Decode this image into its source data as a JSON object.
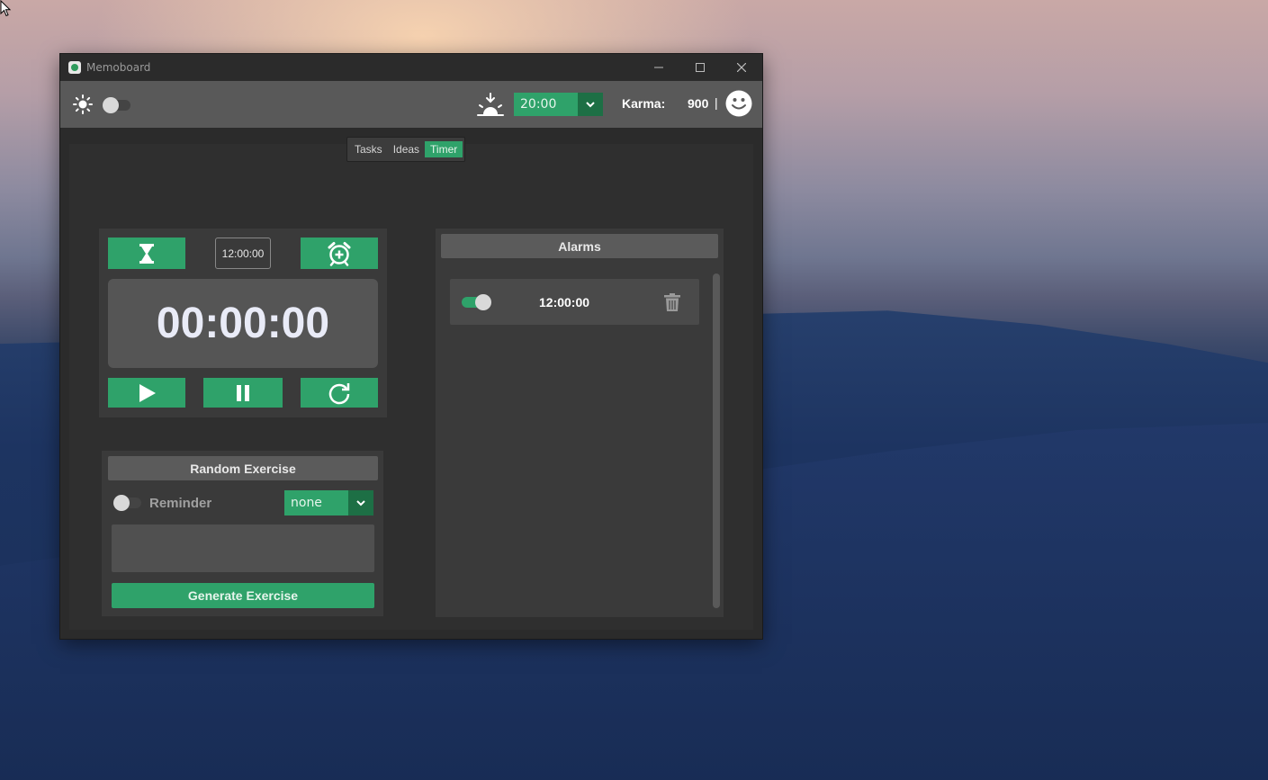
{
  "window": {
    "title": "Memoboard"
  },
  "toolbar": {
    "theme_toggle": "off",
    "time_select": "20:00",
    "karma_label": "Karma:",
    "karma_value": "900",
    "karma_separator": "|"
  },
  "tabs": [
    {
      "label": "Tasks",
      "active": false
    },
    {
      "label": "Ideas",
      "active": false
    },
    {
      "label": "Timer",
      "active": true
    }
  ],
  "timer": {
    "alarm_time_input": "12:00:00",
    "display": "00:00:00"
  },
  "exercise": {
    "title": "Random Exercise",
    "reminder_label": "Reminder",
    "reminder_on": false,
    "interval_select": "none",
    "text": "",
    "generate_label": "Generate Exercise"
  },
  "alarms": {
    "title": "Alarms",
    "items": [
      {
        "time": "12:00:00",
        "enabled": true
      }
    ]
  },
  "colors": {
    "accent": "#2fa26a",
    "accent_dark": "#1d6f45",
    "panel": "#3a3a3a",
    "toolbar": "#595959"
  },
  "icons": [
    "sun-icon",
    "sunset-icon",
    "chevron-down-icon",
    "smiley-icon",
    "hourglass-icon",
    "alarm-add-icon",
    "play-icon",
    "pause-icon",
    "reset-icon",
    "trash-icon",
    "close-icon",
    "maximize-icon",
    "minimize-icon"
  ]
}
